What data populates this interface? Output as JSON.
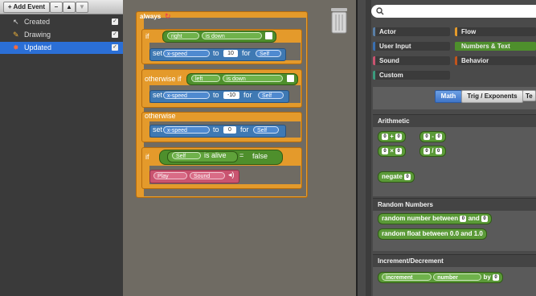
{
  "events_panel": {
    "toolbar": {
      "add_event": "+ Add Event",
      "remove": "–",
      "up": "▲",
      "down": "▼"
    },
    "items": [
      {
        "label": "Created",
        "icon": "cursor-icon",
        "checked": true
      },
      {
        "label": "Drawing",
        "icon": "paintbrush-icon",
        "checked": true
      },
      {
        "label": "Updated",
        "icon": "running-figure-icon",
        "checked": true,
        "selected": true
      }
    ]
  },
  "script": {
    "always": "always",
    "if1": {
      "kw": "if",
      "actor": "right",
      "state": "is down"
    },
    "set1": {
      "kw": "set",
      "attr": "x-speed",
      "to": "to",
      "value": "10",
      "for": "for",
      "target": "Self"
    },
    "otherwise_if": {
      "kw": "otherwise if",
      "actor": "left",
      "state": "is down"
    },
    "set2": {
      "kw": "set",
      "attr": "x-speed",
      "to": "to",
      "value": "-10",
      "for": "for",
      "target": "Self"
    },
    "otherwise": "otherwise",
    "set3": {
      "kw": "set",
      "attr": "x-speed",
      "to": "to",
      "value": "0",
      "for": "for",
      "target": "Self"
    },
    "if2": {
      "kw": "if",
      "actor": "Self",
      "is_alive": "is alive",
      "eq": "=",
      "val": "false"
    },
    "play": {
      "kw": "Play",
      "sound": "Sound",
      "icon": "speaker-icon"
    }
  },
  "palette": {
    "search_placeholder": "",
    "categories": [
      {
        "label": "Actor",
        "color": "#5a7fa6"
      },
      {
        "label": "Flow",
        "color": "#e49a2b"
      },
      {
        "label": "User Input",
        "color": "#3a6fb0"
      },
      {
        "label": "Numbers & Text",
        "color": "#4e8f2c"
      },
      {
        "label": "Sound",
        "color": "#c95470"
      },
      {
        "label": "Behavior",
        "color": "#c2541c"
      },
      {
        "label": "Custom",
        "color": "#3b9a7d"
      }
    ],
    "tabs": [
      "Math",
      "Trig / Exponents",
      "Te"
    ],
    "sections": {
      "arithmetic": "Arithmetic",
      "random": "Random Numbers",
      "increment": "Increment/Decrement"
    },
    "ops": {
      "plus": "+",
      "minus": "-",
      "times": "×",
      "divide": "/"
    },
    "negate": "negate",
    "random_between": {
      "text": "random number between",
      "and": "and"
    },
    "random_float": "random float between 0.0 and 1.0",
    "increment": {
      "mode": "increment",
      "var": "number",
      "by": "by"
    }
  }
}
